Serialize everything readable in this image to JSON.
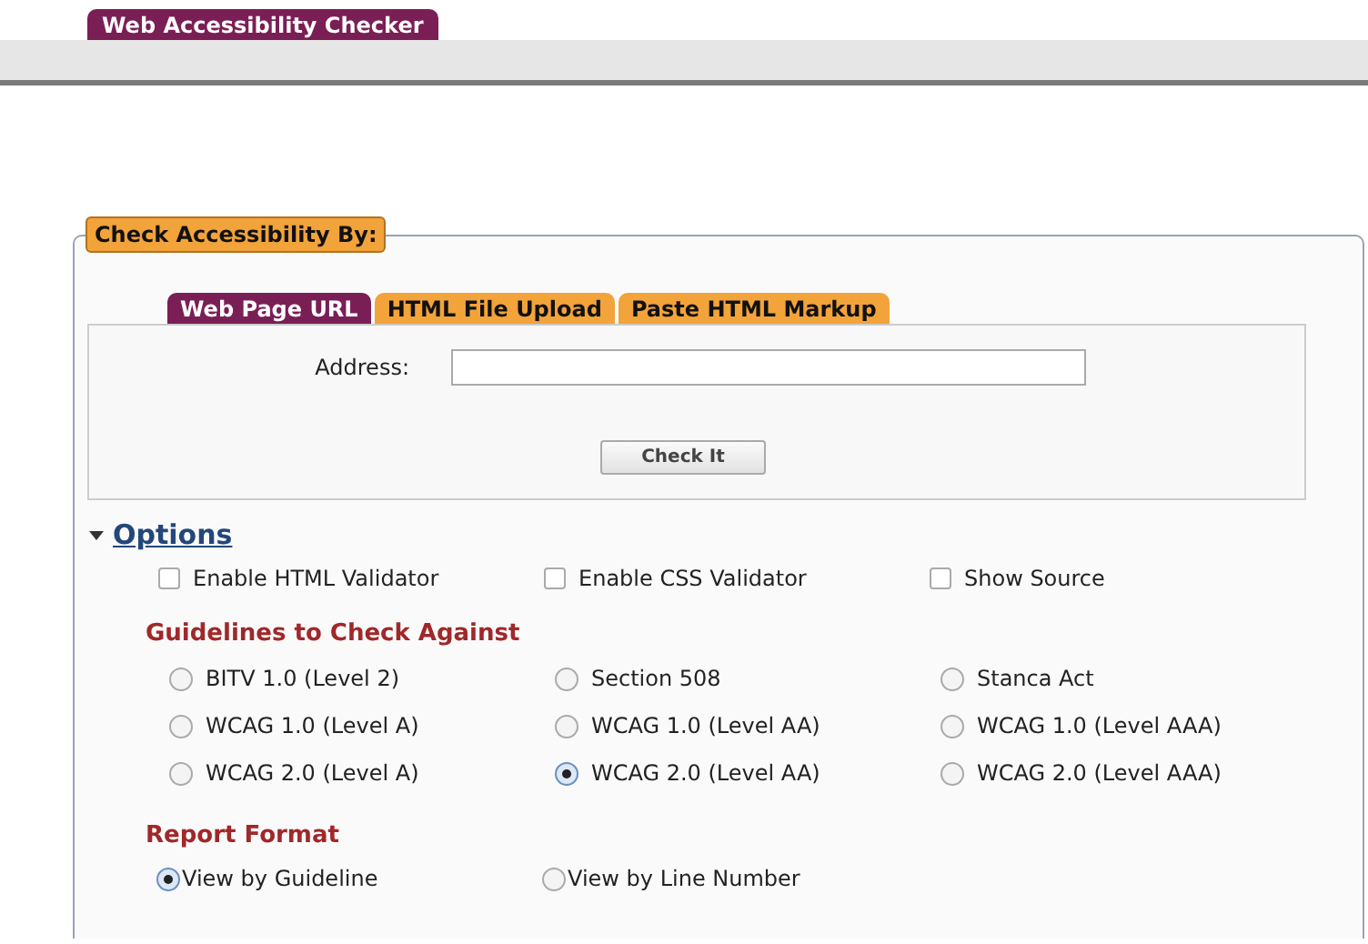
{
  "header_tab": "Web Accessibility Checker",
  "legend": "Check Accessibility By:",
  "tabs": [
    {
      "label": "Web Page URL",
      "selected": true
    },
    {
      "label": "HTML File Upload",
      "selected": false
    },
    {
      "label": "Paste HTML Markup",
      "selected": false
    }
  ],
  "address": {
    "label": "Address:"
  },
  "check_button": "Check It",
  "options": {
    "title": "Options",
    "expanded": true,
    "checkboxes": [
      {
        "label": "Enable HTML Validator",
        "checked": false
      },
      {
        "label": "Enable CSS Validator",
        "checked": false
      },
      {
        "label": "Show Source",
        "checked": false
      }
    ],
    "guidelines_heading": "Guidelines to Check Against",
    "guidelines": [
      {
        "label": "BITV 1.0 (Level 2)",
        "selected": false
      },
      {
        "label": "Section 508",
        "selected": false
      },
      {
        "label": "Stanca Act",
        "selected": false
      },
      {
        "label": "WCAG 1.0 (Level A)",
        "selected": false
      },
      {
        "label": "WCAG 1.0 (Level AA)",
        "selected": false
      },
      {
        "label": "WCAG 1.0 (Level AAA)",
        "selected": false
      },
      {
        "label": "WCAG 2.0 (Level A)",
        "selected": false
      },
      {
        "label": "WCAG 2.0 (Level AA)",
        "selected": true
      },
      {
        "label": "WCAG 2.0 (Level AAA)",
        "selected": false
      }
    ],
    "report_heading": "Report Format",
    "report_formats": [
      {
        "label": "View by Guideline",
        "selected": true
      },
      {
        "label": "View by Line Number",
        "selected": false
      }
    ]
  }
}
